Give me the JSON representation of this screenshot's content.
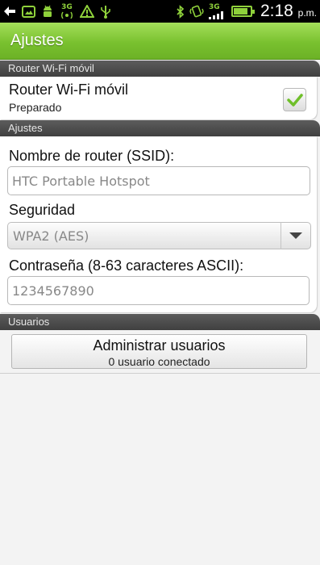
{
  "status_bar": {
    "time": "2:18",
    "ampm": "p.m.",
    "network_label_1": "3G",
    "network_label_2": "3G",
    "battery_level": 0.85,
    "icon_color": "#8fd13b"
  },
  "title_bar": {
    "title": "Ajustes",
    "color": "#79c12f"
  },
  "sections": {
    "router": {
      "header": "Router Wi-Fi móvil",
      "item_title": "Router Wi-Fi móvil",
      "item_status": "Preparado",
      "checked": true
    },
    "settings": {
      "header": "Ajustes",
      "ssid_label": "Nombre de router (SSID):",
      "ssid_value": "HTC Portable Hotspot",
      "security_label": "Seguridad",
      "security_value": "WPA2 (AES)",
      "password_label": "Contraseña (8-63 caracteres ASCII):",
      "password_value": "1234567890"
    },
    "users": {
      "header": "Usuarios",
      "button_title": "Administrar usuarios",
      "button_subtitle": "0 usuario conectado"
    }
  }
}
